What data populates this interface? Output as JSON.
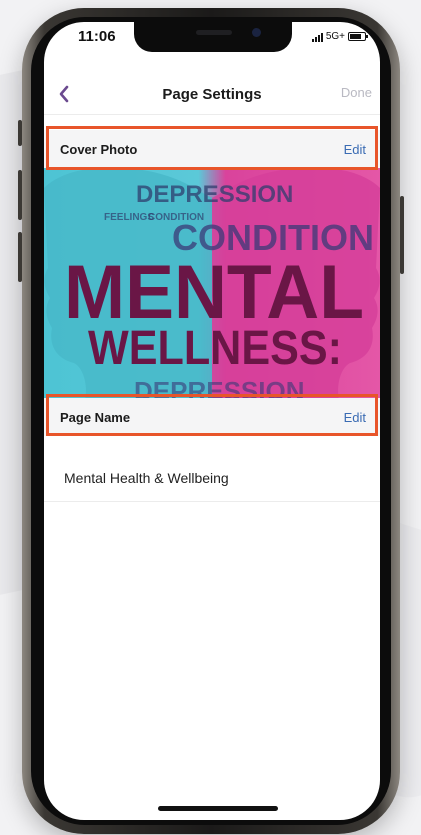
{
  "status_bar": {
    "time": "11:06",
    "network": "5G+"
  },
  "nav": {
    "title": "Page Settings",
    "done_label": "Done",
    "back_icon": "chevron-left-icon"
  },
  "cover_photo": {
    "label": "Cover Photo",
    "edit_label": "Edit",
    "image_words": {
      "top": "DEPRESSION",
      "small1": "FEELINGS",
      "small2": "CONDITION",
      "mid": "CONDITION",
      "big1": "MENTAL",
      "big2": "WELLNESS:",
      "bottom": "DEPRESSION"
    }
  },
  "page_name": {
    "label": "Page Name",
    "edit_label": "Edit",
    "value": "Mental Health & Wellbeing"
  },
  "colors": {
    "accent_link": "#3a6bb3",
    "highlight_border": "#e8552a",
    "nav_back": "#6b4a8f"
  }
}
